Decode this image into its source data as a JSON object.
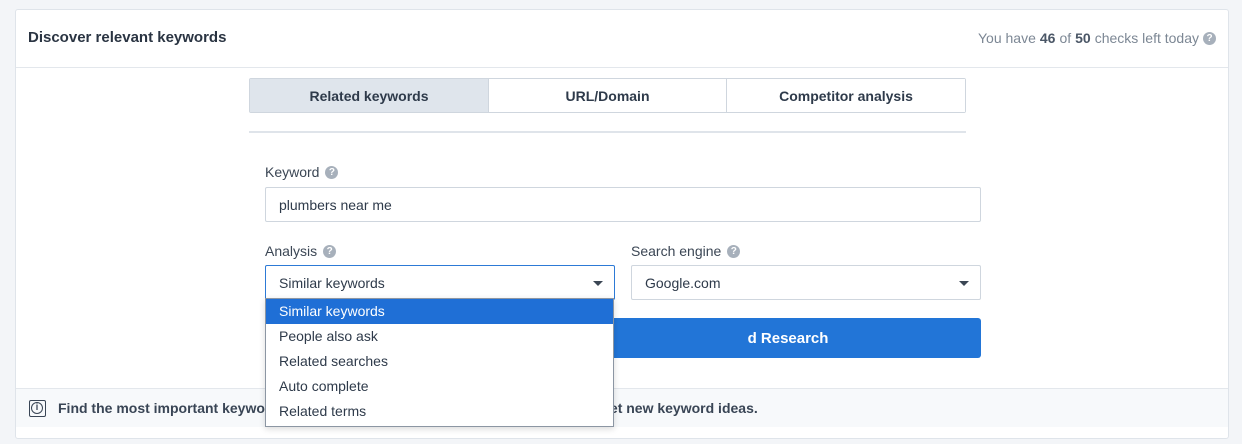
{
  "header": {
    "title": "Discover relevant keywords",
    "quota_prefix": "You have",
    "quota_used": "46",
    "quota_of": "of",
    "quota_total": "50",
    "quota_suffix": "checks left today"
  },
  "tabs": [
    {
      "label": "Related keywords",
      "active": true
    },
    {
      "label": "URL/Domain",
      "active": false
    },
    {
      "label": "Competitor analysis",
      "active": false
    }
  ],
  "keyword": {
    "label": "Keyword",
    "value": "plumbers near me"
  },
  "analysis": {
    "label": "Analysis",
    "selected": "Similar keywords",
    "options": [
      "Similar keywords",
      "People also ask",
      "Related searches",
      "Auto complete",
      "Related terms"
    ]
  },
  "search_engine": {
    "label": "Search engine",
    "selected": "Google.com"
  },
  "button": {
    "label": "Start Keyword Research",
    "visible_label": "d Research"
  },
  "info": {
    "text_left": "Find the most important keywo",
    "text_right": "et new keyword ideas."
  },
  "colors": {
    "accent": "#2275d7",
    "selected_option": "#1f6fd6",
    "active_tab": "#dfe5ec"
  }
}
